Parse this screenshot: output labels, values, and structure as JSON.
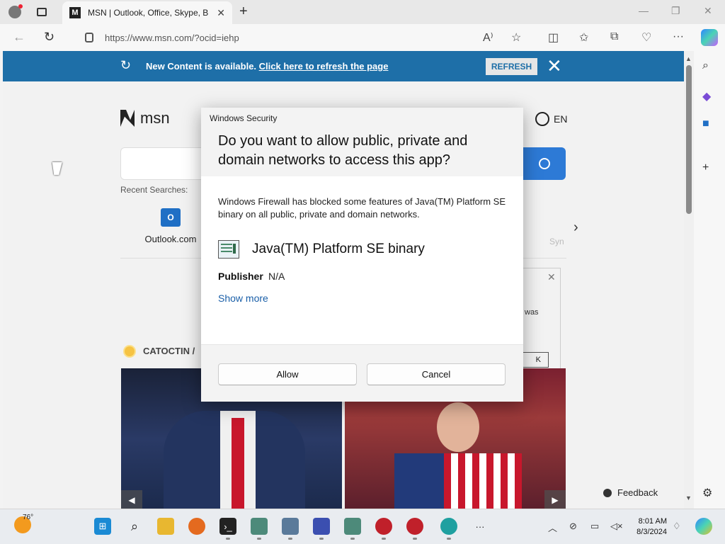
{
  "browser": {
    "tab_title": "MSN | Outlook, Office, Skype, Bi",
    "tab_favicon": "msn-favicon-icon",
    "url": "https://www.msn.com/?ocid=iehp"
  },
  "banner": {
    "text": "New Content is available.",
    "link": "Click here to refresh the page",
    "button": "REFRESH",
    "color": "#1e6fa8"
  },
  "page": {
    "logo_text": "msn",
    "language": "EN",
    "recent_label": "Recent Searches:",
    "quick_link_label": "Outlook.com",
    "quick_link_partial": "Syn",
    "weather_location": "CATOCTIN /",
    "feedback_label": "Feedback",
    "bg_dialog_text": "was",
    "bg_dialog_btn": "K"
  },
  "dialog": {
    "app": "Windows Security",
    "title": "Do you want to allow public, private and domain networks to access this app?",
    "message": "Windows Firewall has blocked some features of Java(TM) Platform SE binary on all public, private and domain networks.",
    "program": "Java(TM) Platform SE binary",
    "publisher_label": "Publisher",
    "publisher_value": "N/A",
    "show_more": "Show more",
    "allow_label": "Allow",
    "cancel_label": "Cancel"
  },
  "taskbar": {
    "temperature": "76°",
    "time": "8:01 AM",
    "date": "8/3/2024"
  }
}
